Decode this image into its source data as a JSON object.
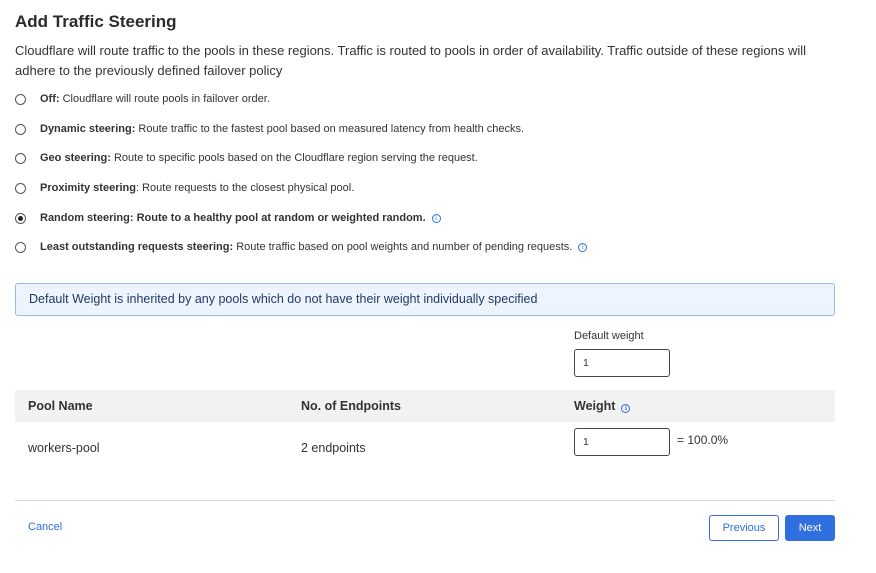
{
  "header": {
    "title": "Add Traffic Steering",
    "description": "Cloudflare will route traffic to the pools in these regions. Traffic is routed to pools in order of availability. Traffic outside of these regions will adhere to the previously defined failover policy"
  },
  "steering_options": [
    {
      "label": "Off:",
      "text": " Cloudflare will route pools in failover order.",
      "checked": false,
      "info": false
    },
    {
      "label": "Dynamic steering:",
      "text": " Route traffic to the fastest pool based on measured latency from health checks.",
      "checked": false,
      "info": false
    },
    {
      "label": "Geo steering:",
      "text": " Route to specific pools based on the Cloudflare region serving the request.",
      "checked": false,
      "info": false
    },
    {
      "label": "Proximity steering",
      "text": ": Route requests to the closest physical pool.",
      "checked": false,
      "info": false
    },
    {
      "label": "Random steering: Route to a healthy pool at random or weighted random.",
      "text": "",
      "checked": true,
      "info": true
    },
    {
      "label": "Least outstanding requests steering:",
      "text": " Route traffic based on pool weights and number of pending requests.",
      "checked": false,
      "info": true
    }
  ],
  "notice": {
    "text": "Default Weight is inherited by any pools which do not have their weight individually specified"
  },
  "default_weight": {
    "label": "Default weight",
    "value": "1"
  },
  "table": {
    "columns": [
      "Pool Name",
      "No. of Endpoints",
      "Weight"
    ],
    "rows": [
      {
        "pool_name": "workers-pool",
        "endpoints": "2 endpoints",
        "weight": "1",
        "percent": "= 100.0%"
      }
    ]
  },
  "footer": {
    "cancel_label": "Cancel",
    "previous_label": "Previous",
    "next_label": "Next"
  },
  "colors": {
    "accent": "#2f6fe0",
    "notice_bg": "#eef4fd",
    "notice_border": "#9bb9e6"
  },
  "icons": {
    "info": "info-icon"
  }
}
